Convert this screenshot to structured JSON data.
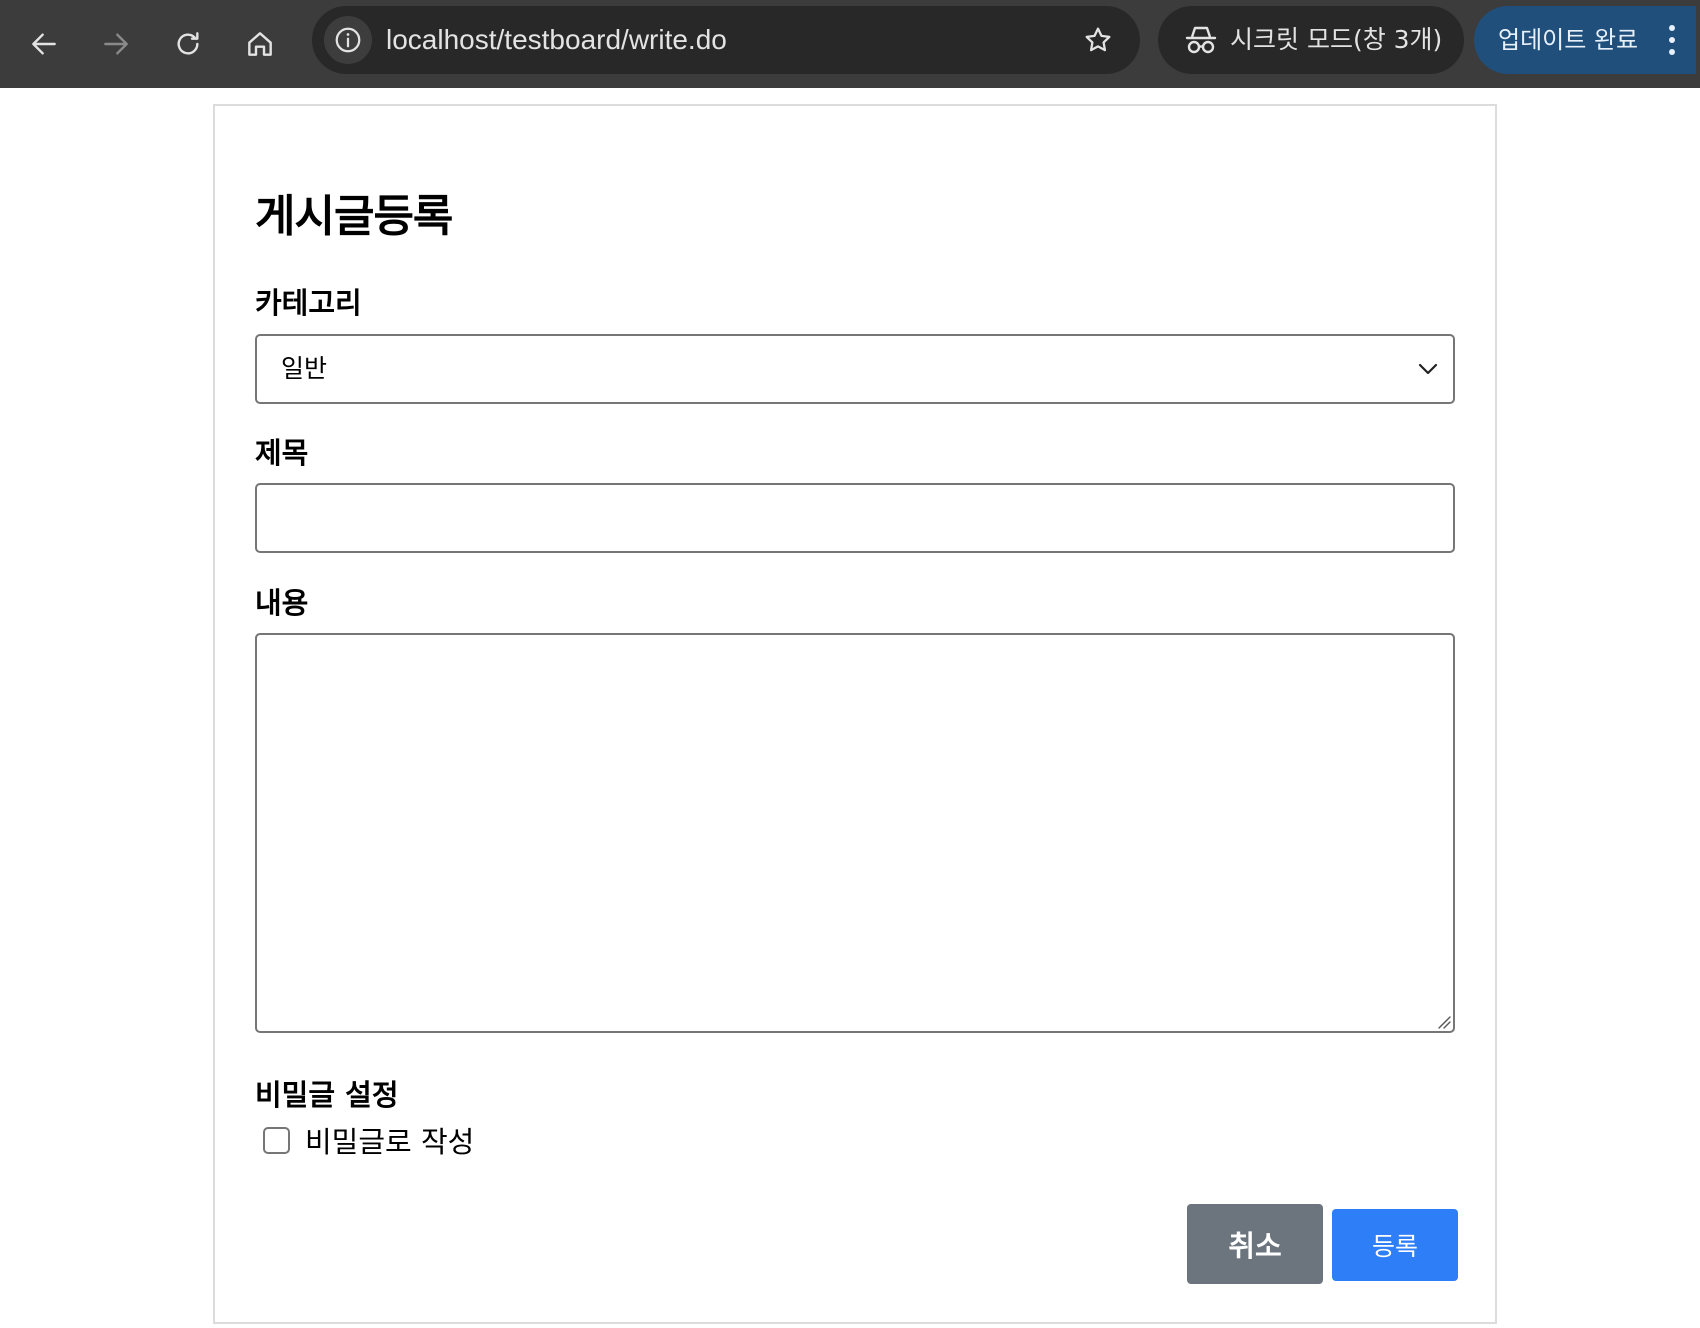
{
  "browser": {
    "url": "localhost/testboard/write.do",
    "incognito_label": "시크릿 모드(창 3개)",
    "update_label": "업데이트 완료"
  },
  "form": {
    "title": "게시글등록",
    "category": {
      "label": "카테고리",
      "selected": "일반"
    },
    "subject": {
      "label": "제목",
      "value": ""
    },
    "content": {
      "label": "내용",
      "value": ""
    },
    "secret": {
      "label": "비밀글 설정",
      "checkbox_label": "비밀글로 작성",
      "checked": false
    },
    "buttons": {
      "cancel": "취소",
      "submit": "등록"
    }
  },
  "colors": {
    "toolbar": "#3c3c3c",
    "omnibox": "#282828",
    "update_button": "#1f4f7a",
    "cancel_button": "#6c757d",
    "submit_button": "#2d7ef7"
  }
}
